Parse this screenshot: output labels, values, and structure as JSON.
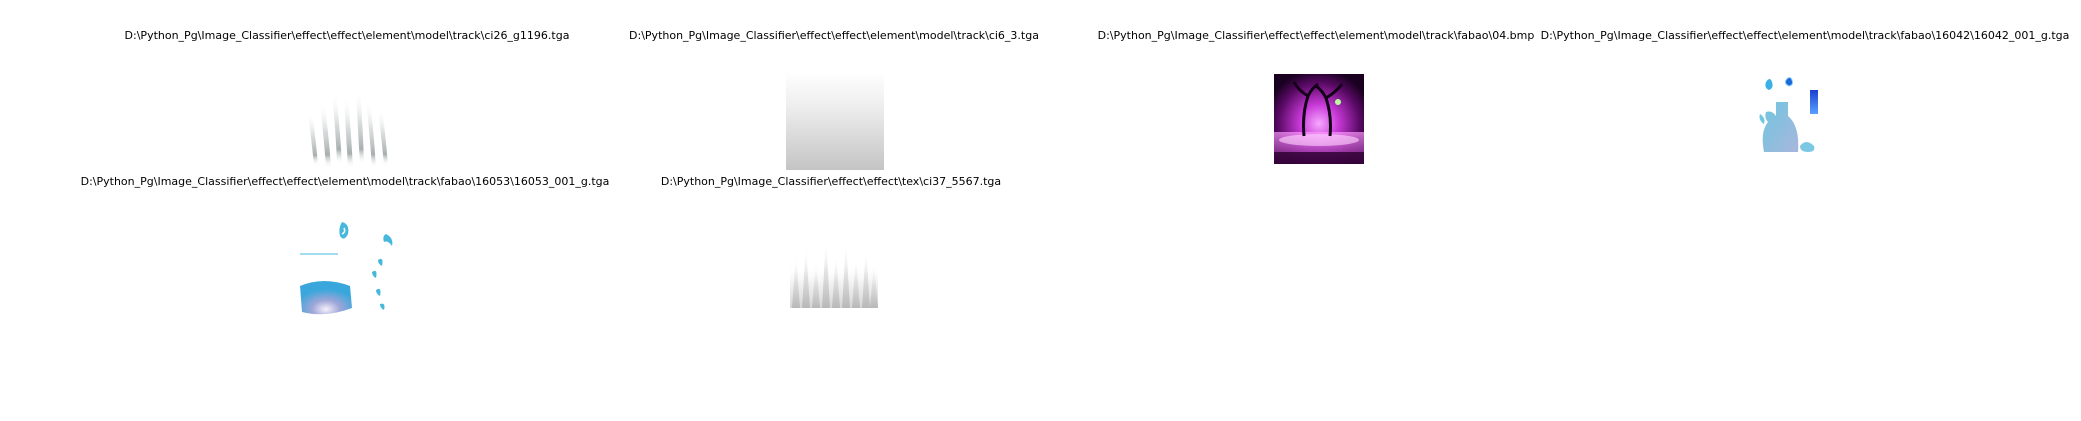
{
  "figure": {
    "panels": [
      {
        "title": "D:\\Python_Pg\\Image_Classifier\\effect\\effect\\element\\model\\track\\ci26_g1196.tga",
        "image": "grey wispy flame streaks on white"
      },
      {
        "title": "D:\\Python_Pg\\Image_Classifier\\effect\\effect\\element\\model\\track\\ci6_3.tga",
        "image": "white-to-grey vertical gradient square"
      },
      {
        "title": "D:\\Python_Pg\\Image_Classifier\\effect\\effect\\element\\model\\track\\fabao\\04.bmp",
        "image": "magenta glowing twisted trees scene"
      },
      {
        "title": "D:\\Python_Pg\\Image_Classifier\\effect\\effect\\element\\model\\track\\fabao\\16042\\16042_001_g.tga",
        "image": "blue bottle texture atlas with droplets"
      },
      {
        "title": "D:\\Python_Pg\\Image_Classifier\\effect\\effect\\element\\model\\track\\fabao\\16053\\16053_001_g.tga",
        "image": "blue curved band and cyan wisps atlas"
      },
      {
        "title": "D:\\Python_Pg\\Image_Classifier\\effect\\effect\\tex\\ci37_5567.tga",
        "image": "grey vertical streak fringe on white"
      }
    ]
  },
  "colors": {
    "background": "#ffffff",
    "caption": "#000000",
    "magenta": "#d640e0",
    "cyan": "#46b8dc"
  }
}
